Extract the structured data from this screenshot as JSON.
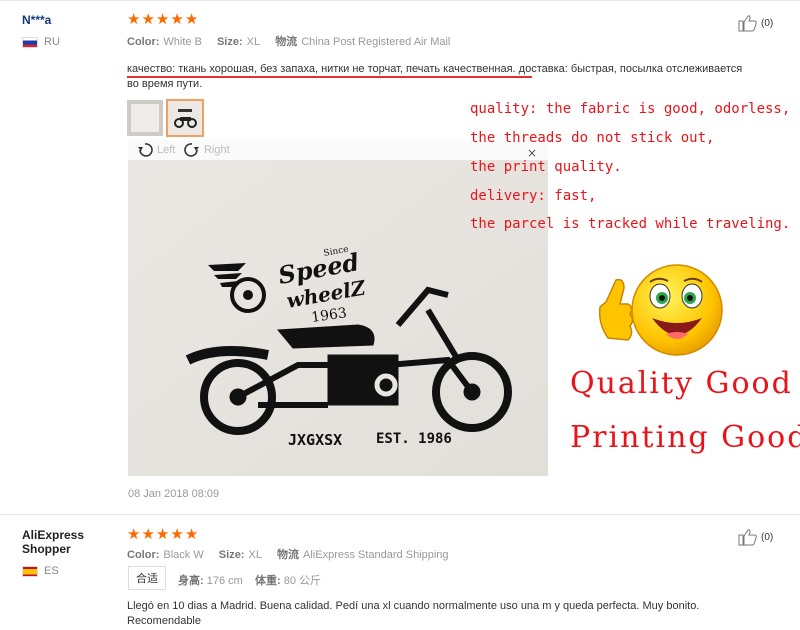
{
  "reviews": [
    {
      "buyer": "N***a",
      "country": "RU",
      "rating": 5,
      "color_label": "Color:",
      "color_value": "White B",
      "size_label": "Size:",
      "size_value": "XL",
      "shipping_label": "物流",
      "shipping_value": "China Post Registered Air Mail",
      "likes": "(0)",
      "text_line1": "качество: ткань хорошая, без запаха, нитки не торчат, печать качественная. доставка: быстрая, посылка отслеживается",
      "text_line2": "во время пути.",
      "rotate_left": "Left",
      "rotate_right": "Right",
      "close": "×",
      "photo_print": {
        "since": "Since",
        "speed": "Speed",
        "wheelz": "wheelZ",
        "year": "1963",
        "brand": "JXGXSX",
        "est": "EST. 1986"
      },
      "annotation_lines": [
        "quality: the fabric is good, odorless,",
        "the threads do not stick out,",
        "the print quality.",
        "delivery: fast,",
        "the parcel is tracked while traveling."
      ],
      "quality_good": "Quality  Good",
      "printing_good": "Printing Good",
      "date": "08 Jan 2018 08:09"
    },
    {
      "buyer_line1": "AliExpress",
      "buyer_line2": "Shopper",
      "country": "ES",
      "rating": 5,
      "color_label": "Color:",
      "color_value": "Black W",
      "size_label": "Size:",
      "size_value": "XL",
      "shipping_label": "物流",
      "shipping_value": "AliExpress Standard Shipping",
      "likes": "(0)",
      "fit": "合适",
      "height_label": "身高:",
      "height_value": "176 cm",
      "weight_label": "体重:",
      "weight_value": "80 公斤",
      "text_line1": "Llegó en 10 dias a Madrid. Buena calidad. Pedí una xl cuando normalmente uso una m y queda perfecta. Muy bonito.",
      "text_line2": "Recomendable"
    }
  ],
  "colors": {
    "star": "#ff6a00",
    "annotation": "#e8141a",
    "buyer": "#14397a"
  },
  "icons": [
    "thumbs-up-icon",
    "rotate-left-icon",
    "rotate-right-icon",
    "close-icon",
    "star-icon",
    "flag-ru-icon",
    "flag-es-icon"
  ]
}
